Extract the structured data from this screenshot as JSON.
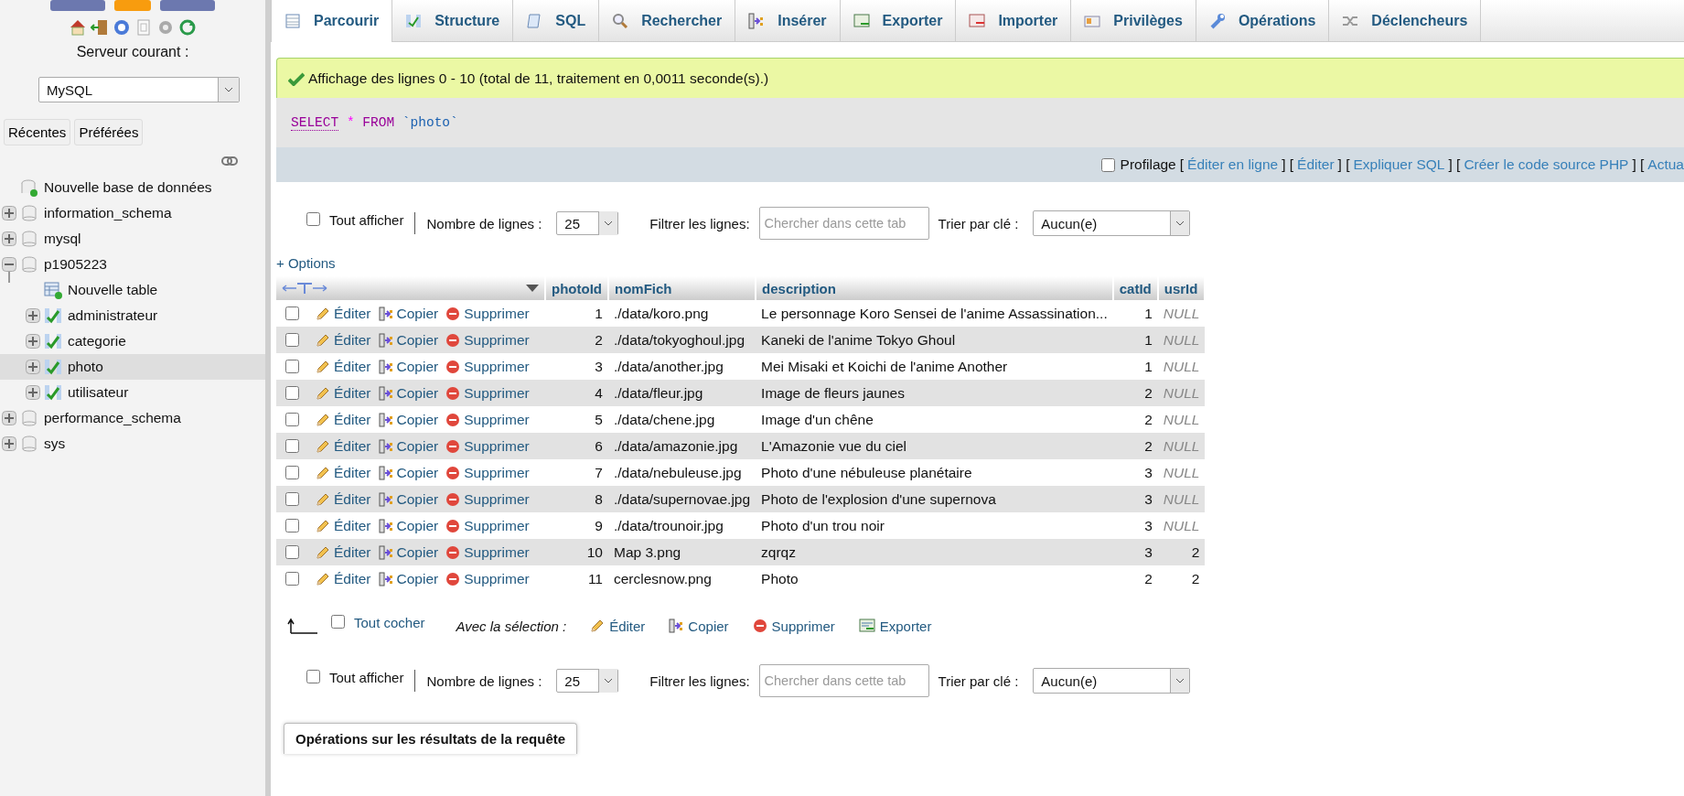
{
  "sidebar": {
    "server_label": "Serveur courant :",
    "server_select": "MySQL",
    "buttons": [
      "Récentes",
      "Préférées"
    ],
    "tree": [
      {
        "label": "Nouvelle base de données",
        "kind": "new-db",
        "selected": false
      },
      {
        "label": "information_schema",
        "kind": "db",
        "expanded": false,
        "selected": false
      },
      {
        "label": "mysql",
        "kind": "db",
        "expanded": false,
        "selected": false
      },
      {
        "label": "p1905223",
        "kind": "db",
        "expanded": true,
        "selected": false,
        "children": [
          {
            "label": "Nouvelle table",
            "kind": "new-table",
            "selected": false
          },
          {
            "label": "administrateur",
            "kind": "table",
            "expanded": false,
            "selected": false
          },
          {
            "label": "categorie",
            "kind": "table",
            "expanded": false,
            "selected": false
          },
          {
            "label": "photo",
            "kind": "table",
            "expanded": false,
            "selected": true
          },
          {
            "label": "utilisateur",
            "kind": "table",
            "expanded": false,
            "selected": false
          }
        ]
      },
      {
        "label": "performance_schema",
        "kind": "db",
        "expanded": false,
        "selected": false
      },
      {
        "label": "sys",
        "kind": "db",
        "expanded": false,
        "selected": false
      }
    ]
  },
  "tabs": [
    {
      "label": "Parcourir",
      "selected": true
    },
    {
      "label": "Structure",
      "selected": false
    },
    {
      "label": "SQL",
      "selected": false
    },
    {
      "label": "Rechercher",
      "selected": false
    },
    {
      "label": "Insérer",
      "selected": false
    },
    {
      "label": "Exporter",
      "selected": false
    },
    {
      "label": "Importer",
      "selected": false
    },
    {
      "label": "Privilèges",
      "selected": false
    },
    {
      "label": "Opérations",
      "selected": false
    },
    {
      "label": "Déclencheurs",
      "selected": false
    }
  ],
  "message": "Affichage des lignes 0 - 10 (total de 11, traitement en 0,0011 seconde(s).)",
  "sql_query": [
    {
      "text": "SELECT",
      "kind": "keyword"
    },
    {
      "text": "*",
      "kind": "operator"
    },
    {
      "text": "FROM",
      "kind": "keyword"
    },
    {
      "text": "`photo`",
      "kind": "identifier"
    }
  ],
  "profiling": {
    "label": "Profilage",
    "checked": false,
    "items": [
      {
        "text": "[",
        "kind": "bracket"
      },
      {
        "text": "Éditer en ligne",
        "kind": "link"
      },
      {
        "text": "] [",
        "kind": "bracket"
      },
      {
        "text": "Éditer",
        "kind": "link"
      },
      {
        "text": "] [",
        "kind": "bracket"
      },
      {
        "text": "Expliquer SQL",
        "kind": "link"
      },
      {
        "text": "] [",
        "kind": "bracket"
      },
      {
        "text": "Créer le code source PHP",
        "kind": "link"
      },
      {
        "text": "] [",
        "kind": "bracket"
      },
      {
        "text": "Actua",
        "kind": "link"
      }
    ]
  },
  "navigation": [
    {
      "show_all": "Tout afficher",
      "show_all_checked": false,
      "rows_label": "Nombre de lignes :",
      "rows_value": "25",
      "filter_label": "Filtrer les lignes:",
      "filter_placeholder": "Chercher dans cette tab",
      "sort_label": "Trier par clé :",
      "sort_value": "Aucun(e)"
    },
    {
      "show_all": "Tout afficher",
      "show_all_checked": false,
      "rows_label": "Nombre de lignes :",
      "rows_value": "25",
      "filter_label": "Filtrer les lignes:",
      "filter_placeholder": "Chercher dans cette tab",
      "sort_label": "Trier par clé :",
      "sort_value": "Aucun(e)"
    }
  ],
  "options_link": "+ Options",
  "table": {
    "columns": [
      {
        "label": "photoId",
        "kind": "number"
      },
      {
        "label": "nomFich",
        "kind": "text"
      },
      {
        "label": "description",
        "kind": "text"
      },
      {
        "label": "catId",
        "kind": "number"
      },
      {
        "label": "usrId",
        "kind": "number"
      }
    ],
    "rows": [
      {
        "checked": false,
        "actions": [
          "Éditer",
          "Copier",
          "Supprimer"
        ],
        "cells": [
          "1",
          "./data/koro.png",
          "Le personnage Koro Sensei de l'anime Assassination...",
          "1",
          "NULL"
        ],
        "usrId_null": true
      },
      {
        "checked": false,
        "actions": [
          "Éditer",
          "Copier",
          "Supprimer"
        ],
        "cells": [
          "2",
          "./data/tokyoghoul.jpg",
          "Kaneki de l'anime Tokyo Ghoul",
          "1",
          "NULL"
        ],
        "usrId_null": true
      },
      {
        "checked": false,
        "actions": [
          "Éditer",
          "Copier",
          "Supprimer"
        ],
        "cells": [
          "3",
          "./data/another.jpg",
          "Mei Misaki et Koichi de l'anime Another",
          "1",
          "NULL"
        ],
        "usrId_null": true
      },
      {
        "checked": false,
        "actions": [
          "Éditer",
          "Copier",
          "Supprimer"
        ],
        "cells": [
          "4",
          "./data/fleur.jpg",
          "Image de fleurs jaunes",
          "2",
          "NULL"
        ],
        "usrId_null": true
      },
      {
        "checked": false,
        "actions": [
          "Éditer",
          "Copier",
          "Supprimer"
        ],
        "cells": [
          "5",
          "./data/chene.jpg",
          "Image d'un chêne",
          "2",
          "NULL"
        ],
        "usrId_null": true
      },
      {
        "checked": false,
        "actions": [
          "Éditer",
          "Copier",
          "Supprimer"
        ],
        "cells": [
          "6",
          "./data/amazonie.jpg",
          "L'Amazonie vue du ciel",
          "2",
          "NULL"
        ],
        "usrId_null": true
      },
      {
        "checked": false,
        "actions": [
          "Éditer",
          "Copier",
          "Supprimer"
        ],
        "cells": [
          "7",
          "./data/nebuleuse.jpg",
          "Photo d'une nébuleuse planétaire",
          "3",
          "NULL"
        ],
        "usrId_null": true
      },
      {
        "checked": false,
        "actions": [
          "Éditer",
          "Copier",
          "Supprimer"
        ],
        "cells": [
          "8",
          "./data/supernovae.jpg",
          "Photo de l'explosion d'une supernova",
          "3",
          "NULL"
        ],
        "usrId_null": true
      },
      {
        "checked": false,
        "actions": [
          "Éditer",
          "Copier",
          "Supprimer"
        ],
        "cells": [
          "9",
          "./data/trounoir.jpg",
          "Photo d'un trou noir",
          "3",
          "NULL"
        ],
        "usrId_null": true
      },
      {
        "checked": false,
        "actions": [
          "Éditer",
          "Copier",
          "Supprimer"
        ],
        "cells": [
          "10",
          "Map 3.png",
          "zqrqz",
          "3",
          "2"
        ],
        "usrId_null": false
      },
      {
        "checked": false,
        "actions": [
          "Éditer",
          "Copier",
          "Supprimer"
        ],
        "cells": [
          "11",
          "cerclesnow.png",
          "Photo",
          "2",
          "2"
        ],
        "usrId_null": false
      }
    ]
  },
  "bulk": {
    "check_all": "Tout cocher",
    "check_all_checked": false,
    "with_selection": "Avec la sélection :",
    "actions": [
      "Éditer",
      "Copier",
      "Supprimer",
      "Exporter"
    ]
  },
  "operations_title": "Opérations sur les résultats de la requête"
}
